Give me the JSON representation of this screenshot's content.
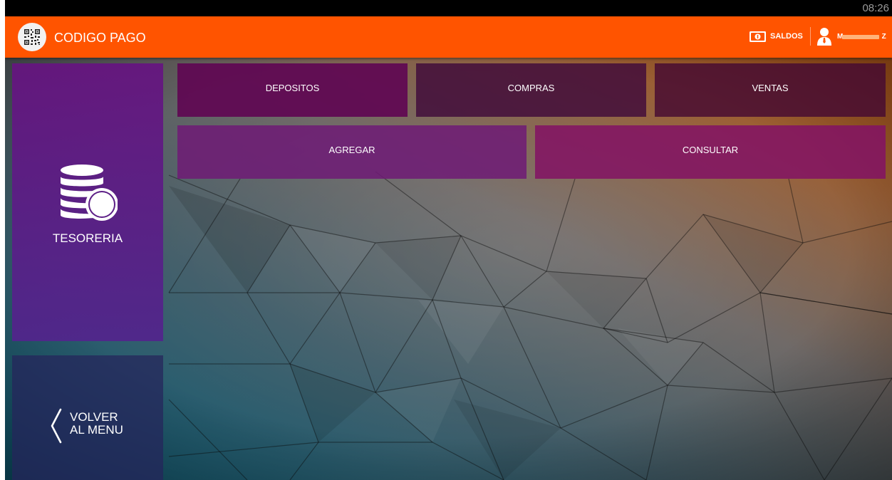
{
  "status_bar": {
    "time": "08:26"
  },
  "app_bar": {
    "title": "CODIGO PAGO",
    "balances_label": "SALDOS",
    "user_name": "M",
    "user_name_suffix": "Z",
    "logo_icon": "qr-code-icon",
    "balances_icon": "banknote-icon",
    "user_icon": "user-icon"
  },
  "sidebar": {
    "section_title": "TESORERIA",
    "section_icon": "coins-stack-icon",
    "back_label_line1": "VOLVER",
    "back_label_line2": "AL MENU",
    "back_icon": "chevron-left-icon"
  },
  "actions": {
    "depositos": "DEPOSITOS",
    "compras": "COMPRAS",
    "ventas": "VENTAS",
    "agregar": "AGREGAR",
    "consultar": "CONSULTAR"
  },
  "colors": {
    "accent": "#ff5400",
    "sidebar_tile": "#661480",
    "back_tile": "#26245c",
    "text": "#ffffff"
  }
}
